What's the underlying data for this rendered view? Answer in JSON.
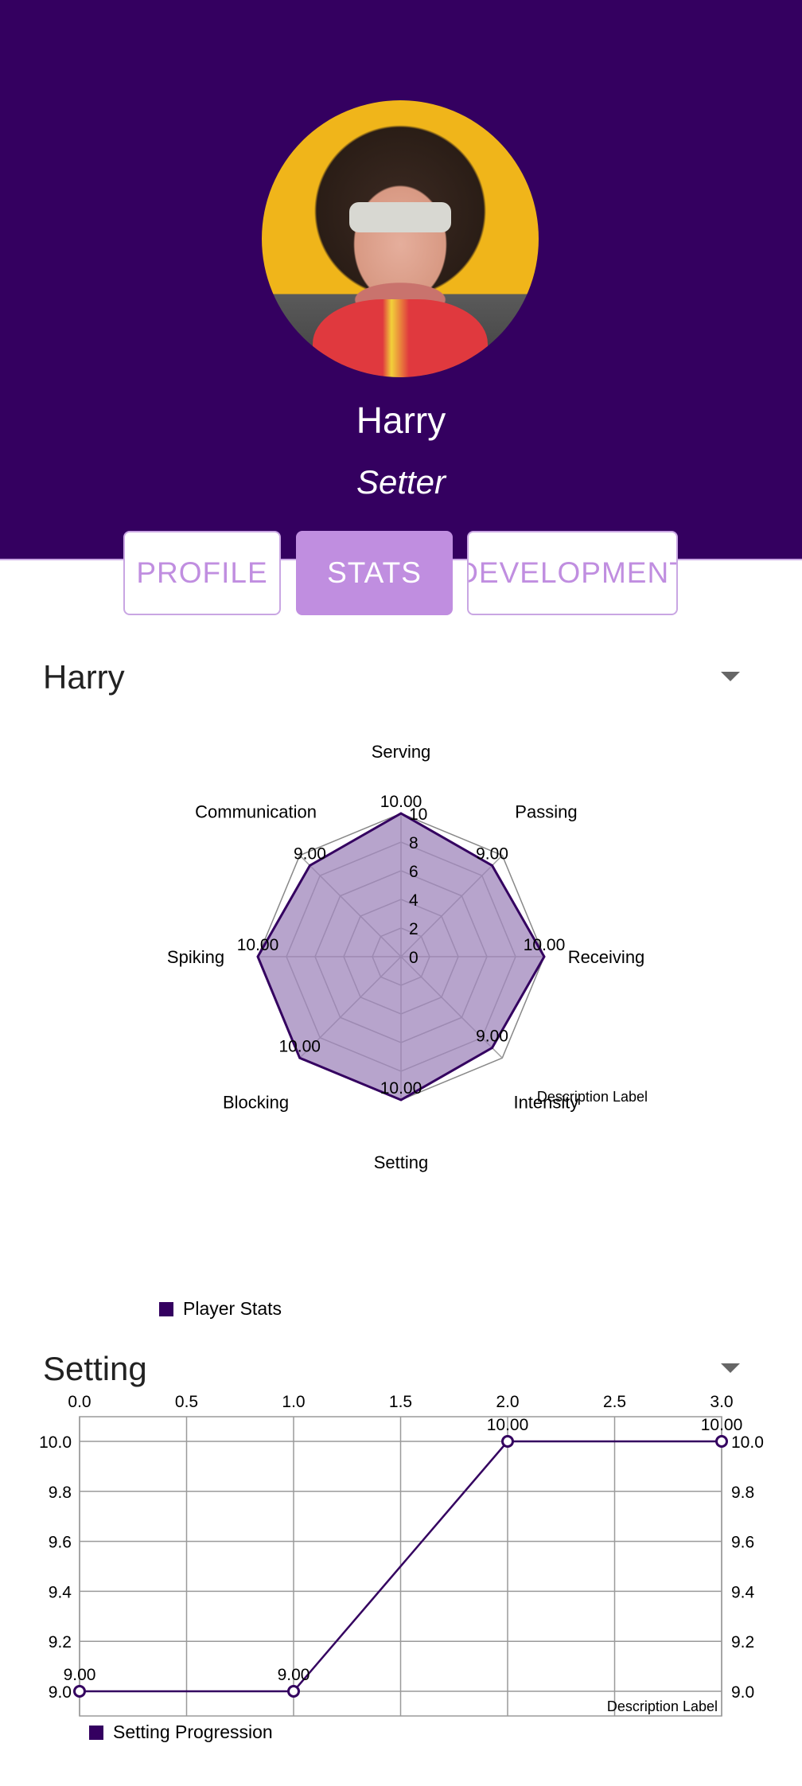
{
  "profile": {
    "name": "Harry",
    "position": "Setter"
  },
  "tabs": [
    {
      "label": "PROFILE",
      "active": false
    },
    {
      "label": "STATS",
      "active": true
    },
    {
      "label": "DEVELOPMENT",
      "active": false
    }
  ],
  "player_selector": {
    "value": "Harry"
  },
  "stat_selector": {
    "value": "Setting"
  },
  "colors": {
    "primary": "#340060",
    "accent": "#c08ee0",
    "radar_fill": "#9b81b8"
  },
  "chart_data": [
    {
      "type": "radar",
      "categories": [
        "Serving",
        "Passing",
        "Receiving",
        "Intensity",
        "Setting",
        "Blocking",
        "Spiking",
        "Communication"
      ],
      "series": [
        {
          "name": "Player Stats",
          "values": [
            10,
            9,
            10,
            9,
            10,
            10,
            10,
            9
          ]
        }
      ],
      "value_labels": [
        "10.00",
        "9.00",
        "10.00",
        "9.00",
        "10.00",
        "10.00",
        "10.00",
        "9.00"
      ],
      "axis_ticks": [
        "0",
        "2",
        "4",
        "6",
        "8",
        "10"
      ],
      "range": [
        0,
        10
      ],
      "description": "Description Label",
      "legend": "bottom-left"
    },
    {
      "type": "line",
      "x": [
        0,
        1,
        2,
        3
      ],
      "series": [
        {
          "name": "Setting Progression",
          "values": [
            9.0,
            9.0,
            10.0,
            10.0
          ]
        }
      ],
      "value_labels": [
        "9.00",
        "9.00",
        "10.00",
        "10.00"
      ],
      "x_ticks": [
        "0.0",
        "0.5",
        "1.0",
        "1.5",
        "2.0",
        "2.5",
        "3.0"
      ],
      "y_ticks": [
        "9.0",
        "9.2",
        "9.4",
        "9.6",
        "9.8",
        "10.0"
      ],
      "xlim": [
        0,
        3
      ],
      "ylim": [
        9.0,
        10.0
      ],
      "grid": true,
      "description": "Description Label",
      "legend": "bottom-left"
    }
  ]
}
